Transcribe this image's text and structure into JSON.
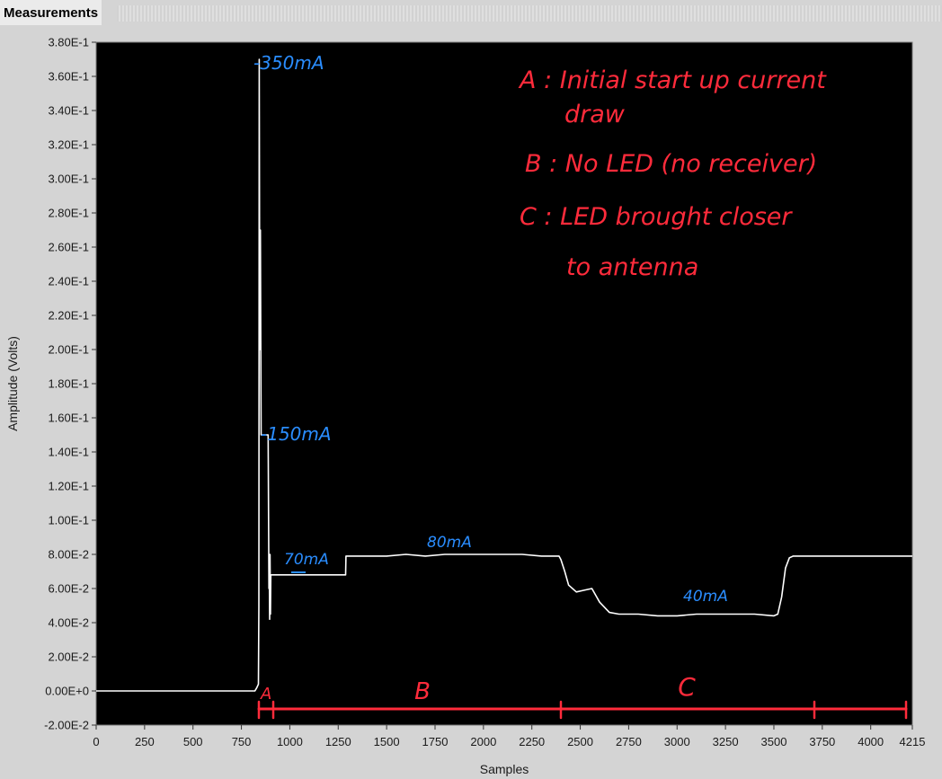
{
  "window": {
    "panel_title": "Measurements"
  },
  "chart_data": {
    "type": "line",
    "xlabel": "Samples",
    "ylabel": "Amplitude (Volts)",
    "xlim": [
      0,
      4215
    ],
    "ylim": [
      -0.02,
      0.38
    ],
    "x_ticks": [
      "0",
      "250",
      "500",
      "750",
      "1000",
      "1250",
      "1500",
      "1750",
      "2000",
      "2250",
      "2500",
      "2750",
      "3000",
      "3250",
      "3500",
      "3750",
      "4000",
      "4215"
    ],
    "y_ticks": [
      "3.80E-1",
      "3.60E-1",
      "3.40E-1",
      "3.20E-1",
      "3.00E-1",
      "2.80E-1",
      "2.60E-1",
      "2.40E-1",
      "2.20E-1",
      "2.00E-1",
      "1.80E-1",
      "1.60E-1",
      "1.40E-1",
      "1.20E-1",
      "1.00E-1",
      "8.00E-2",
      "6.00E-2",
      "4.00E-2",
      "2.00E-2",
      "0.00E+0",
      "-2.00E-2"
    ],
    "background": "#000000",
    "series_color": "#ffffff",
    "series": [
      {
        "x": [
          0,
          820,
          830,
          838,
          840,
          842,
          845,
          848,
          852,
          856,
          858,
          862,
          866,
          868,
          880,
          886,
          888,
          892,
          894,
          896,
          898,
          900,
          902,
          906,
          910,
          920,
          1000,
          1100,
          1200,
          1288,
          1290,
          1300,
          1500,
          1600,
          1700,
          1800,
          1900,
          2000,
          2100,
          2200,
          2300,
          2350,
          2390,
          2400,
          2420,
          2440,
          2480,
          2520,
          2560,
          2600,
          2650,
          2700,
          2750,
          2800,
          2900,
          3000,
          3100,
          3200,
          3300,
          3400,
          3500,
          3520,
          3540,
          3560,
          3580,
          3600,
          3620,
          3700,
          3800,
          3900,
          4000,
          4100,
          4215
        ],
        "y": [
          0.0,
          0.0,
          0.002,
          0.004,
          0.05,
          0.37,
          0.2,
          0.27,
          0.15,
          0.15,
          0.15,
          0.15,
          0.15,
          0.15,
          0.15,
          0.15,
          0.15,
          0.06,
          0.07,
          0.042,
          0.08,
          0.045,
          0.068,
          0.068,
          0.068,
          0.068,
          0.068,
          0.068,
          0.068,
          0.068,
          0.079,
          0.079,
          0.079,
          0.08,
          0.079,
          0.08,
          0.08,
          0.08,
          0.08,
          0.08,
          0.079,
          0.079,
          0.079,
          0.077,
          0.07,
          0.062,
          0.058,
          0.059,
          0.06,
          0.052,
          0.046,
          0.045,
          0.045,
          0.045,
          0.044,
          0.044,
          0.045,
          0.045,
          0.045,
          0.045,
          0.044,
          0.045,
          0.055,
          0.072,
          0.078,
          0.079,
          0.079,
          0.079,
          0.079,
          0.079,
          0.079,
          0.079,
          0.079
        ]
      }
    ],
    "annotations": {
      "peak_label": "-350mA",
      "step_label": "-150mA",
      "label_70": "70mA",
      "label_80": "80mA",
      "label_40": "40mA",
      "marker_a": "A",
      "marker_b": "B",
      "marker_c": "C",
      "legend_line1": "A : Initial start up current",
      "legend_line2": "draw",
      "legend_line3": "B : No LED (no receiver)",
      "legend_line4": "C : LED brought closer",
      "legend_line5": "to antenna",
      "red_color": "#ff2b3b",
      "blue_color": "#2a8dff"
    }
  }
}
